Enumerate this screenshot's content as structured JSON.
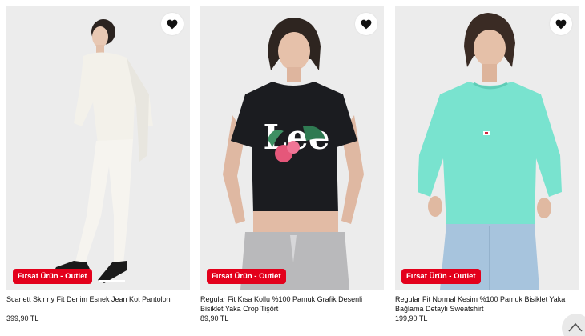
{
  "products": [
    {
      "title": "Scarlett Skinny Fit Denim Esnek Jean Kot Pantolon",
      "price": "399,90 TL",
      "badge": "Fırsat Ürün - Outlet",
      "favorite_icon": "heart-icon",
      "photo_bg": "#ececec"
    },
    {
      "title": "Regular Fit Kısa Kollu %100 Pamuk Grafik Desenli Bisiklet Yaka Crop Tişört",
      "price": "89,90 TL",
      "badge": "Fırsat Ürün - Outlet",
      "favorite_icon": "heart-icon",
      "photo_bg": "#ececec"
    },
    {
      "title": "Regular Fit Normal Kesim %100 Pamuk Bisiklet Yaka Bağlama Detaylı Sweatshirt",
      "price": "199,90 TL",
      "badge": "Fırsat Ürün - Outlet",
      "favorite_icon": "heart-icon",
      "photo_bg": "#ececec"
    }
  ],
  "product_photos": [
    {
      "garment": "white sweater and white skinny jeans",
      "garment_color": "#f3f1ea"
    },
    {
      "garment": "black crop t-shirt with floral Lee print, grey sweatpants",
      "garment_color": "#1b1c20"
    },
    {
      "garment": "mint sweatshirt and light blue jeans",
      "garment_color": "#79e3cf"
    }
  ],
  "graphic_text": "Lee",
  "colors": {
    "badge_bg": "#e3001b",
    "badge_text": "#ffffff",
    "page_bg": "#ffffff",
    "text": "#111111"
  },
  "scroll_top": {
    "icon": "chevron-up-icon"
  }
}
